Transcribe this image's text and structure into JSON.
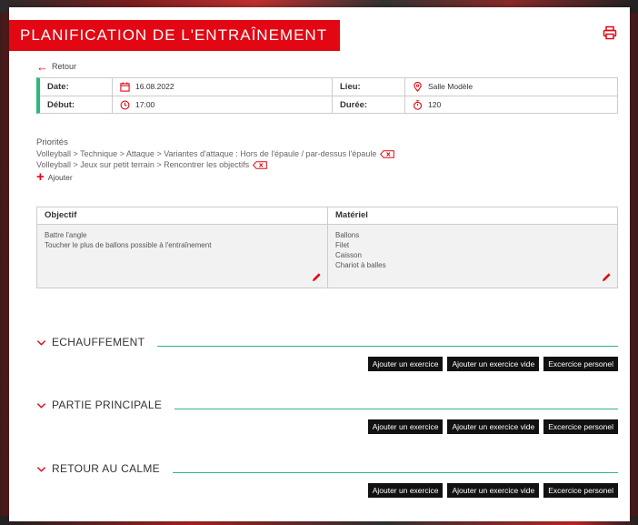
{
  "page": {
    "title": "PLANIFICATION DE L'ENTRAÎNEMENT",
    "back_label": "Retour"
  },
  "info": {
    "date_label": "Date:",
    "date_value": "16.08.2022",
    "place_label": "Lieu:",
    "place_value": "Salle Modèle",
    "start_label": "Début:",
    "start_value": "17:00",
    "duration_label": "Durée:",
    "duration_value": "120"
  },
  "priorities": {
    "heading": "Priorités",
    "items": [
      "Volleyball > Technique > Attaque > Variantes d'attaque : Hors de l'épaule / par-dessus l'épaule",
      "Volleyball > Jeux sur petit terrain > Rencontrer les objectifs"
    ],
    "add_label": "Ajouter"
  },
  "objectives": {
    "objective_header": "Objectif",
    "objective_items": [
      "Battre l'angle",
      "Toucher le plus de ballons possible à l'entraînement"
    ],
    "material_header": "Matériel",
    "material_items": [
      "Ballons",
      "Filet",
      "Caisson",
      "Chariot à balles"
    ]
  },
  "sections": [
    {
      "title": "ECHAUFFEMENT"
    },
    {
      "title": "PARTIE PRINCIPALE"
    },
    {
      "title": "RETOUR AU CALME"
    }
  ],
  "buttons": {
    "add_exercise": "Ajouter un exercice",
    "add_empty_exercise": "Ajouter un exercice vide",
    "personal_exercise": "Excercice personel"
  },
  "colors": {
    "accent_red": "#e30613",
    "accent_green": "#2db87d"
  },
  "icons": {
    "print": "printer-icon",
    "date": "calendar-icon",
    "place": "location-pin-icon",
    "start": "clock-icon",
    "duration": "stopwatch-icon",
    "edit": "pencil-icon",
    "remove": "delete-tag-icon",
    "collapse": "chevron-down-icon"
  }
}
